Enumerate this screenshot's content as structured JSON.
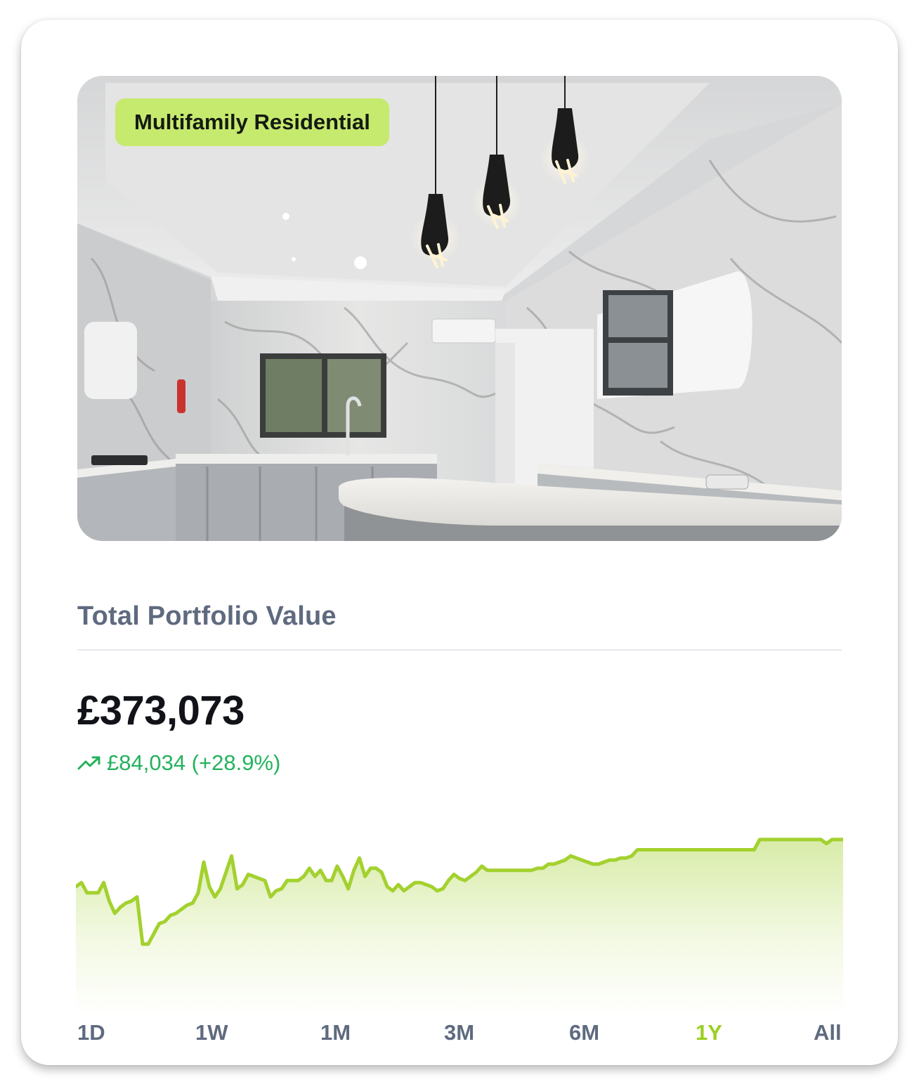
{
  "property": {
    "badge": "Multifamily Residential",
    "photo_subject": "kitchen-photo"
  },
  "portfolio": {
    "title": "Total Portfolio Value",
    "value": "£373,073",
    "change_text": "£84,034 (+28.9%)",
    "change_icon": "trending-up-icon"
  },
  "colors": {
    "badge_bg": "#c6ea6e",
    "accent": "#9ad020",
    "chart_line": "#a3d12f",
    "positive": "#24b25d",
    "muted_text": "#5f6a7f"
  },
  "chart_data": {
    "type": "area",
    "xlabel": "",
    "ylabel": "",
    "grid": false,
    "ylim": [
      0,
      100
    ],
    "values": [
      63,
      65,
      60,
      60,
      60,
      65,
      56,
      50,
      53,
      55,
      56,
      58,
      35,
      35,
      40,
      45,
      46,
      49,
      50,
      52,
      54,
      55,
      60,
      75,
      63,
      58,
      62,
      70,
      78,
      62,
      64,
      69,
      68,
      67,
      66,
      58,
      61,
      62,
      66,
      66,
      66,
      68,
      72,
      68,
      71,
      66,
      66,
      73,
      68,
      62,
      71,
      77,
      68,
      72,
      72,
      70,
      63,
      61,
      64,
      61,
      63,
      65,
      65,
      64,
      63,
      61,
      62,
      66,
      69,
      67,
      66,
      68,
      70,
      73,
      71,
      71,
      71,
      71,
      71,
      71,
      71,
      71,
      71,
      72,
      72,
      74,
      74,
      75,
      76,
      78,
      77,
      76,
      75,
      74,
      74,
      75,
      76,
      76,
      77,
      77,
      78,
      81,
      81,
      81,
      81,
      81,
      81,
      81,
      81,
      81,
      81,
      81,
      81,
      81,
      81,
      81,
      81,
      81,
      81,
      81,
      81,
      81,
      81,
      86,
      86,
      86,
      86,
      86,
      86,
      86,
      86,
      86,
      86,
      86,
      86,
      84,
      86,
      86,
      86
    ],
    "ranges": [
      "1D",
      "1W",
      "1M",
      "3M",
      "6M",
      "1Y",
      "All"
    ],
    "selected_range": "1Y"
  }
}
